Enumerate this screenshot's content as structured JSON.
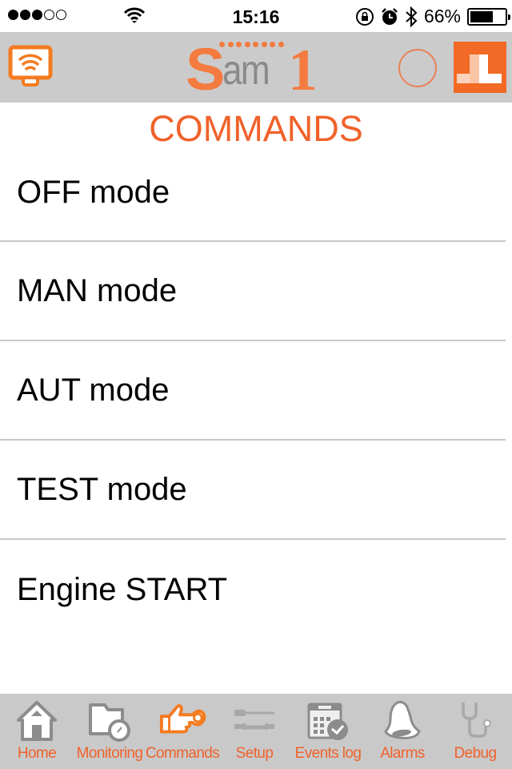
{
  "status_bar": {
    "signal_bars_filled": 3,
    "signal_bars_total": 5,
    "time": "15:16",
    "battery_percent_label": "66%",
    "battery_level": 0.66
  },
  "nav_bar": {
    "left_icon": "remote-display-icon",
    "logo": {
      "s": "S",
      "am": "am",
      "one": "1"
    },
    "connection_indicator": "circle-icon",
    "brand_icon": "brand-logo-icon"
  },
  "page": {
    "title": "COMMANDS"
  },
  "commands": [
    {
      "label": "OFF mode"
    },
    {
      "label": "MAN mode"
    },
    {
      "label": "AUT mode"
    },
    {
      "label": "TEST mode"
    },
    {
      "label": "Engine START"
    }
  ],
  "tab_bar": {
    "active_index": 2,
    "colors": {
      "label": "#f0622b",
      "active_icon": "#f47b20",
      "inactive_icon": "#8c8c8c"
    },
    "tabs": [
      {
        "label": "Home",
        "icon": "home-icon"
      },
      {
        "label": "Monitoring",
        "icon": "monitoring-icon"
      },
      {
        "label": "Commands",
        "icon": "pointing-hand-icon"
      },
      {
        "label": "Setup",
        "icon": "tools-icon"
      },
      {
        "label": "Events log",
        "icon": "calendar-check-icon"
      },
      {
        "label": "Alarms",
        "icon": "bell-icon"
      },
      {
        "label": "Debug",
        "icon": "stethoscope-icon"
      }
    ]
  }
}
